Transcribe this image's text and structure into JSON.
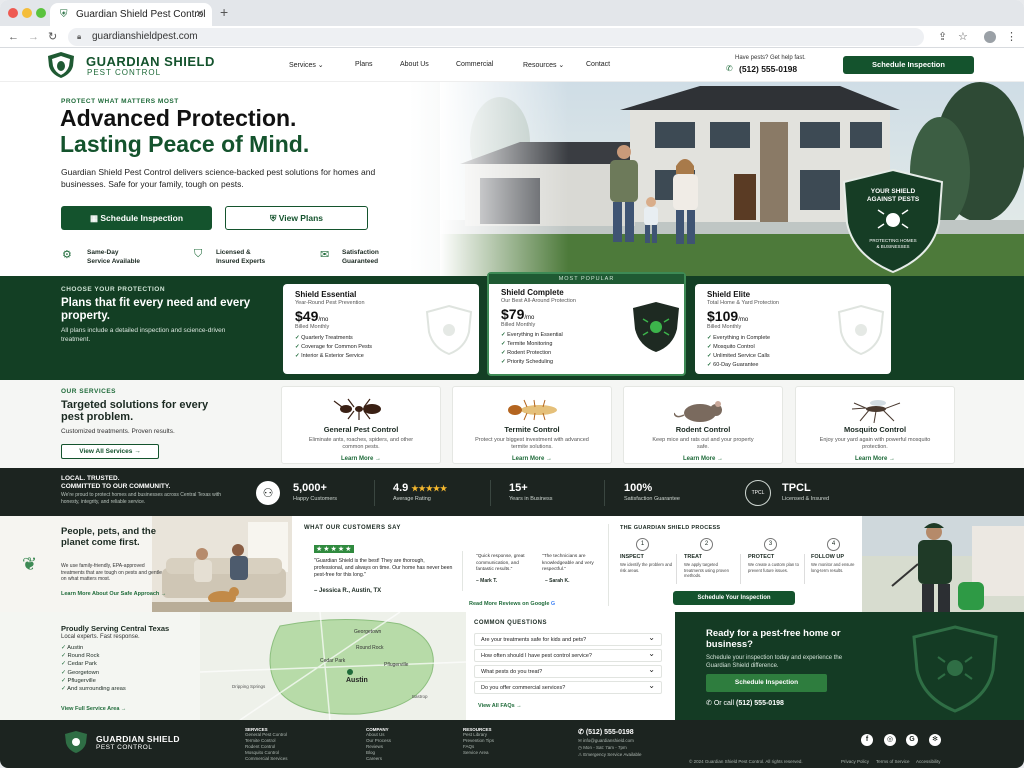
{
  "browser": {
    "tab_title": "Guardian Shield Pest Control",
    "url": "guardianshieldpest.com"
  },
  "brand": {
    "name": "GUARDIAN SHIELD",
    "sub": "PEST CONTROL"
  },
  "nav": [
    "Services",
    "Plans",
    "About Us",
    "Commercial",
    "Resources",
    "Contact"
  ],
  "header": {
    "help": "Have pests? Get help fast.",
    "phone": "(512) 555-0198",
    "cta": "Schedule Inspection"
  },
  "hero": {
    "eyebrow": "PROTECT WHAT MATTERS MOST",
    "h1a": "Advanced Protection.",
    "h1b": "Lasting Peace of Mind.",
    "text": "Guardian Shield Pest Control delivers science-backed pest solutions for homes and businesses. Safe for your family, tough on pests.",
    "btn1": "Schedule Inspection",
    "btn2": "View Plans",
    "features": [
      {
        "a": "Same-Day",
        "b": "Service Available"
      },
      {
        "a": "Licensed &",
        "b": "Insured Experts"
      },
      {
        "a": "Satisfaction",
        "b": "Guaranteed"
      }
    ],
    "badge_a": "YOUR SHIELD",
    "badge_b": "AGAINST PESTS",
    "badge_c": "PROTECTING HOMES",
    "badge_d": "& BUSINESSES"
  },
  "plans": {
    "eyebrow": "CHOOSE YOUR PROTECTION",
    "title": "Plans that fit every need and every property.",
    "text": "All plans include a detailed inspection and science-driven treatment.",
    "popular": "MOST POPULAR",
    "items": [
      {
        "name": "Shield Essential",
        "sub": "Year-Round Pest Prevention",
        "price": "$49",
        "per": "/mo",
        "billed": "Billed Monthly",
        "f": [
          "Quarterly Treatments",
          "Coverage for Common Pests",
          "Interior & Exterior Service"
        ]
      },
      {
        "name": "Shield Complete",
        "sub": "Our Best All-Around Protection",
        "price": "$79",
        "per": "/mo",
        "billed": "Billed Monthly",
        "f": [
          "Everything in Essential",
          "Termite Monitoring",
          "Rodent Protection",
          "Priority Scheduling"
        ]
      },
      {
        "name": "Shield Elite",
        "sub": "Total Home & Yard Protection",
        "price": "$109",
        "per": "/mo",
        "billed": "Billed Monthly",
        "f": [
          "Everything in Complete",
          "Mosquito Control",
          "Unlimited Service Calls",
          "60-Day Guarantee"
        ]
      }
    ]
  },
  "services": {
    "eyebrow": "OUR SERVICES",
    "title": "Targeted solutions for every pest problem.",
    "text": "Customized treatments. Proven results.",
    "btn": "View All Services →",
    "items": [
      {
        "name": "General Pest Control",
        "d": "Eliminate ants, roaches, spiders, and other common pests.",
        "m": "Learn More →"
      },
      {
        "name": "Termite Control",
        "d": "Protect your biggest investment with advanced termite solutions.",
        "m": "Learn More →"
      },
      {
        "name": "Rodent Control",
        "d": "Keep mice and rats out and your property safe.",
        "m": "Learn More →"
      },
      {
        "name": "Mosquito Control",
        "d": "Enjoy your yard again with powerful mosquito protection.",
        "m": "Learn More →"
      }
    ]
  },
  "stats": {
    "ta": "LOCAL. TRUSTED.",
    "tb": "COMMITTED TO OUR COMMUNITY.",
    "text": "We're proud to protect homes and businesses across Central Texas with honesty, integrity, and reliable service.",
    "items": [
      {
        "v": "5,000+",
        "l": "Happy Customers"
      },
      {
        "v": "4.9",
        "l": "Average Rating",
        "stars": "★★★★★"
      },
      {
        "v": "15+",
        "l": "Years in Business"
      },
      {
        "v": "100%",
        "l": "Satisfaction Guarantee"
      },
      {
        "v": "TPCL",
        "l": "Licensed & Insured"
      }
    ]
  },
  "planet": {
    "title": "People, pets, and the planet come first.",
    "text": "We use family-friendly, EPA-approved treatments that are tough on pests and gentle on what matters most.",
    "link": "Learn More About Our Safe Approach →"
  },
  "reviews": {
    "title": "WHAT OUR CUSTOMERS SAY",
    "stars": "★★★★★",
    "main": "\"Guardian Shield is the best! They are thorough, professional, and always on time. Our home has never been pest-free for this long.\"",
    "author": "– Jessica R., Austin, TX",
    "q2": "\"Quick response, great communication, and fantastic results.\"",
    "a2": "– Mark T.",
    "q3": "\"The technicians are knowledgeable and very respectful.\"",
    "a3": "– Sarah K.",
    "link": "Read More Reviews on Google"
  },
  "process": {
    "title": "THE GUARDIAN SHIELD PROCESS",
    "btn": "Schedule Your Inspection",
    "steps": [
      {
        "n": "1",
        "t": "INSPECT",
        "d": "We identify the problem and risk areas."
      },
      {
        "n": "2",
        "t": "TREAT",
        "d": "We apply targeted treatments using proven methods."
      },
      {
        "n": "3",
        "t": "PROTECT",
        "d": "We create a custom plan to prevent future issues."
      },
      {
        "n": "4",
        "t": "FOLLOW UP",
        "d": "We monitor and ensure long-term results."
      }
    ]
  },
  "area": {
    "title": "Proudly Serving Central Texas",
    "sub": "Local experts. Fast response.",
    "cities": [
      "Austin",
      "Round Rock",
      "Cedar Park",
      "Georgetown",
      "Pflugerville",
      "And surrounding areas"
    ],
    "link": "View Full Service Area →",
    "map": [
      "Georgetown",
      "Round Rock",
      "Cedar Park",
      "Pflugerville",
      "Austin",
      "Dripping Springs",
      "Bastrop"
    ]
  },
  "faq": {
    "title": "COMMON QUESTIONS",
    "items": [
      "Are your treatments safe for kids and pets?",
      "How often should I have pest control service?",
      "What pests do you treat?",
      "Do you offer commercial services?"
    ],
    "link": "View All FAQs →"
  },
  "cta": {
    "title": "Ready for a pest-free home or business?",
    "text": "Schedule your inspection today and experience the Guardian Shield difference.",
    "btn": "Schedule Inspection",
    "call": "Or call",
    "phone": "(512) 555-0198"
  },
  "footer": {
    "services_h": "SERVICES",
    "services": [
      "General Pest Control",
      "Termite Control",
      "Rodent Control",
      "Mosquito Control",
      "Commercial Services"
    ],
    "company_h": "COMPANY",
    "company": [
      "About Us",
      "Our Process",
      "Reviews",
      "Blog",
      "Careers"
    ],
    "resources_h": "RESOURCES",
    "resources": [
      "Pest Library",
      "Prevention Tips",
      "FAQs",
      "Service Area"
    ],
    "phone": "(512) 555-0198",
    "email": "info@guardianshield.com",
    "hours": "Mon - Sat: 7am - 7pm",
    "emergency": "Emergency Service Available",
    "copy": "© 2024 Guardian Shield Pest Control. All rights reserved.",
    "legal": [
      "Privacy Policy",
      "Terms of Service",
      "Accessibility"
    ]
  }
}
